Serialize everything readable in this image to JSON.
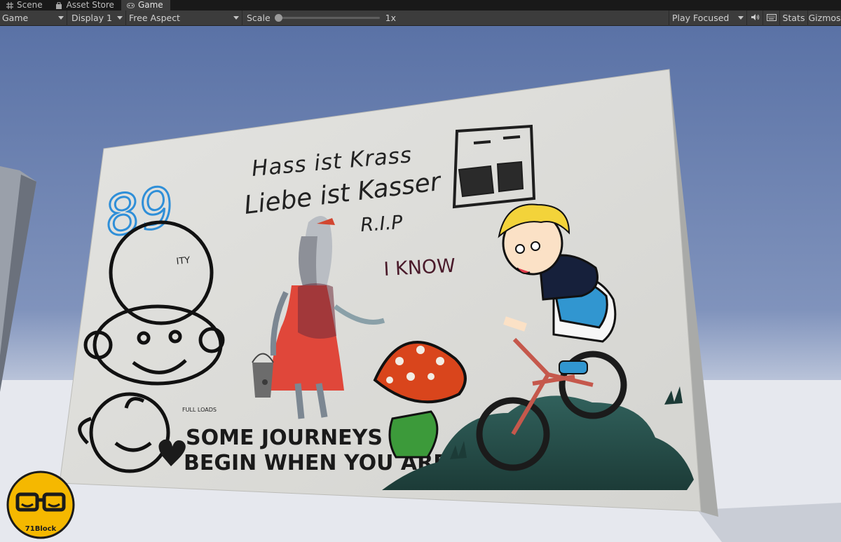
{
  "tabs": [
    {
      "label": "Scene",
      "icon": "grid-icon"
    },
    {
      "label": "Asset Store",
      "icon": "shopping-bag-icon"
    },
    {
      "label": "Game",
      "icon": "gamepad-icon"
    }
  ],
  "toolbar": {
    "view_dropdown": "Game",
    "display_dropdown": "Display 1",
    "aspect_dropdown": "Free Aspect",
    "scale_label": "Scale",
    "scale_value": "1x",
    "scale_level": 0.0,
    "play_mode": "Play Focused",
    "audio_icon": "speaker-icon",
    "stats_icon": "keyboard-icon",
    "stats_label": "Stats",
    "gizmos_label": "Gizmos"
  },
  "scene": {
    "sky_color": "#5b74a8",
    "horizon_color": "#e8ebf2",
    "wall_color": "#dcdcd8",
    "graffiti": {
      "line1": "Hass ist Krass",
      "line2": "Liebe ist Kasser",
      "line3": "R.I.P",
      "line4": "I KNOW",
      "tag": "89",
      "slogan_small": "FULL LOADS",
      "slogan_line1": "SOME JOURNEYS",
      "slogan_line2": "BEGIN WHEN YOU ARRIVE",
      "side_letters": "ITY",
      "mushroom_color": "#d9451c",
      "dress_color": "#e0473a"
    }
  },
  "watermark": {
    "label": "71Block",
    "color": "#f5b800"
  }
}
